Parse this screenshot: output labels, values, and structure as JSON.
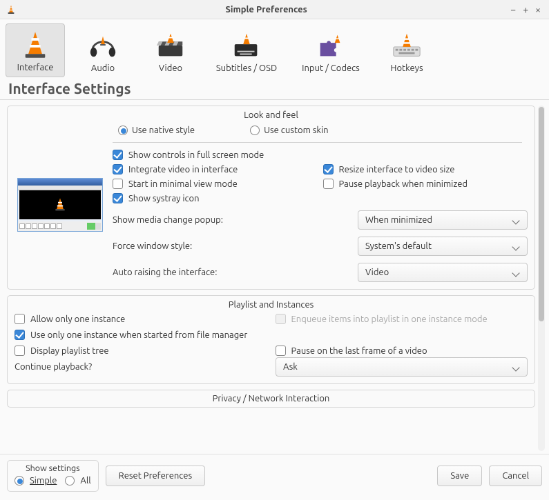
{
  "window": {
    "title": "Simple Preferences"
  },
  "toolbar": {
    "items": [
      {
        "label": "Interface"
      },
      {
        "label": "Audio"
      },
      {
        "label": "Video"
      },
      {
        "label": "Subtitles / OSD"
      },
      {
        "label": "Input / Codecs"
      },
      {
        "label": "Hotkeys"
      }
    ]
  },
  "section_title": "Interface Settings",
  "look_and_feel": {
    "title": "Look and feel",
    "native": "Use native style",
    "custom": "Use custom skin",
    "show_controls_fullscreen": "Show controls in full screen mode",
    "integrate_video": "Integrate video in interface",
    "resize_interface": "Resize interface to video size",
    "start_minimal": "Start in minimal view mode",
    "pause_minimized": "Pause playback when minimized",
    "show_systray": "Show systray icon",
    "media_change_label": "Show media change popup:",
    "media_change_value": "When minimized",
    "force_style_label": "Force window style:",
    "force_style_value": "System's default",
    "auto_raise_label": "Auto raising the interface:",
    "auto_raise_value": "Video"
  },
  "playlist": {
    "title": "Playlist and Instances",
    "only_one": "Allow only one instance",
    "enqueue": "Enqueue items into playlist in one instance mode",
    "one_from_fm": "Use only one instance when started from file manager",
    "display_tree": "Display playlist tree",
    "pause_last_frame": "Pause on the last frame of a video",
    "continue_label": "Continue playback?",
    "continue_value": "Ask"
  },
  "truncated_title": "Privacy / Network Interaction",
  "footer": {
    "show_settings": "Show settings",
    "simple": "Simple",
    "all": "All",
    "reset": "Reset Preferences",
    "save": "Save",
    "cancel": "Cancel"
  }
}
